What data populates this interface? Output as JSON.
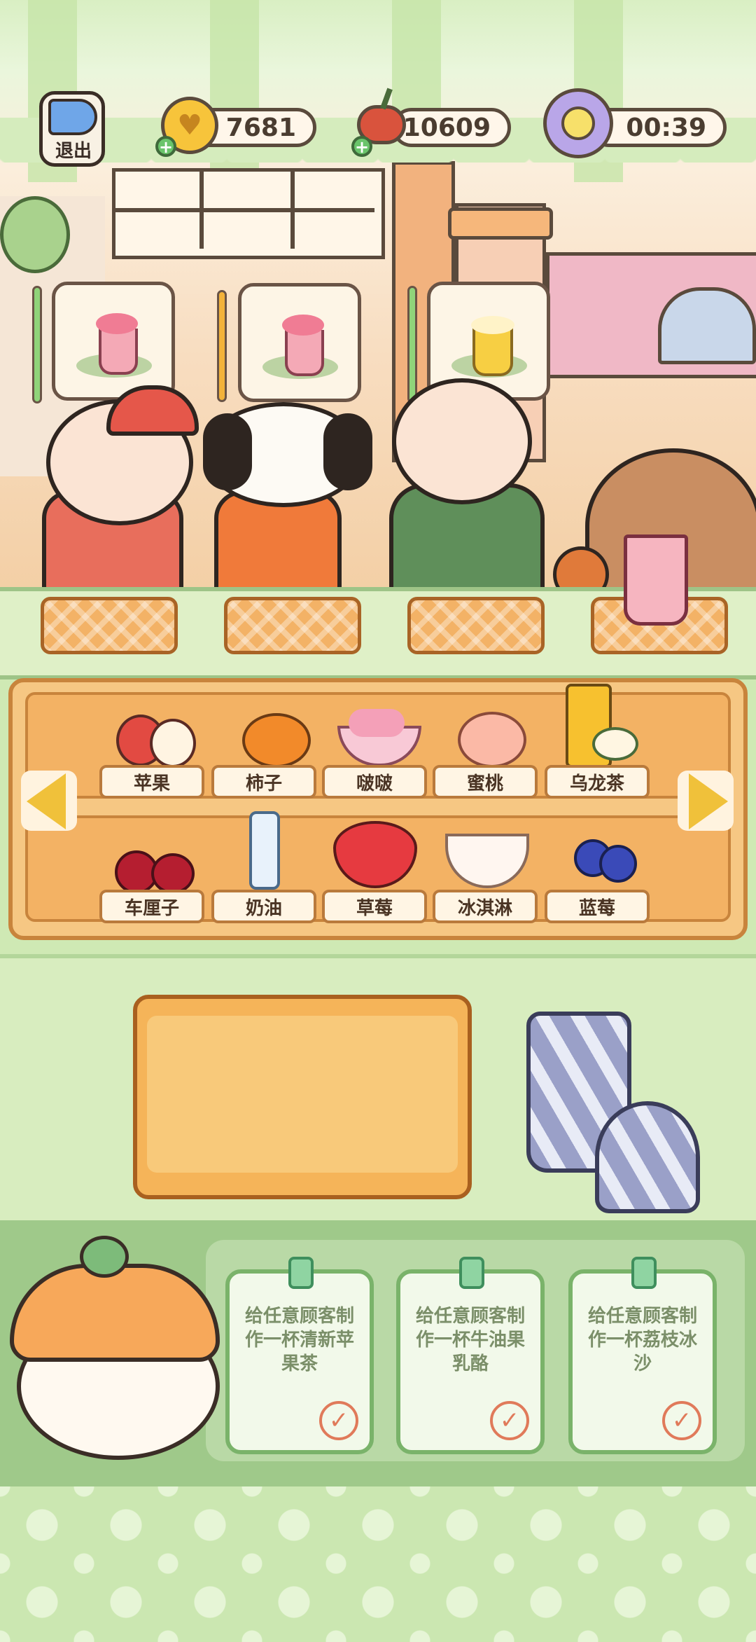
{
  "top_bar": {
    "exit_label": "退出",
    "coins": "7681",
    "berries": "10609",
    "timer": "00:39"
  },
  "orders": [
    {
      "name": "pink-smoothie",
      "timer_color": "#8fd47a"
    },
    {
      "name": "pink-smoothie",
      "timer_color": "#f3b23a"
    },
    {
      "name": "yellow-drink",
      "timer_color": "#8fd47a"
    }
  ],
  "served_drink": "apple-tea",
  "ingredients": {
    "row1": [
      "苹果",
      "柿子",
      "啵啵",
      "蜜桃",
      "乌龙茶"
    ],
    "row2": [
      "车厘子",
      "奶油",
      "草莓",
      "冰淇淋",
      "蓝莓"
    ]
  },
  "tasks": [
    "给任意顾客制作一杯清新苹果茶",
    "给任意顾客制作一杯牛油果乳酪",
    "给任意顾客制作一杯荔枝冰沙"
  ],
  "colors": {
    "shelf": "#f6c783",
    "task_border": "#7ab36a",
    "pill_bg": "#fff6ea"
  }
}
